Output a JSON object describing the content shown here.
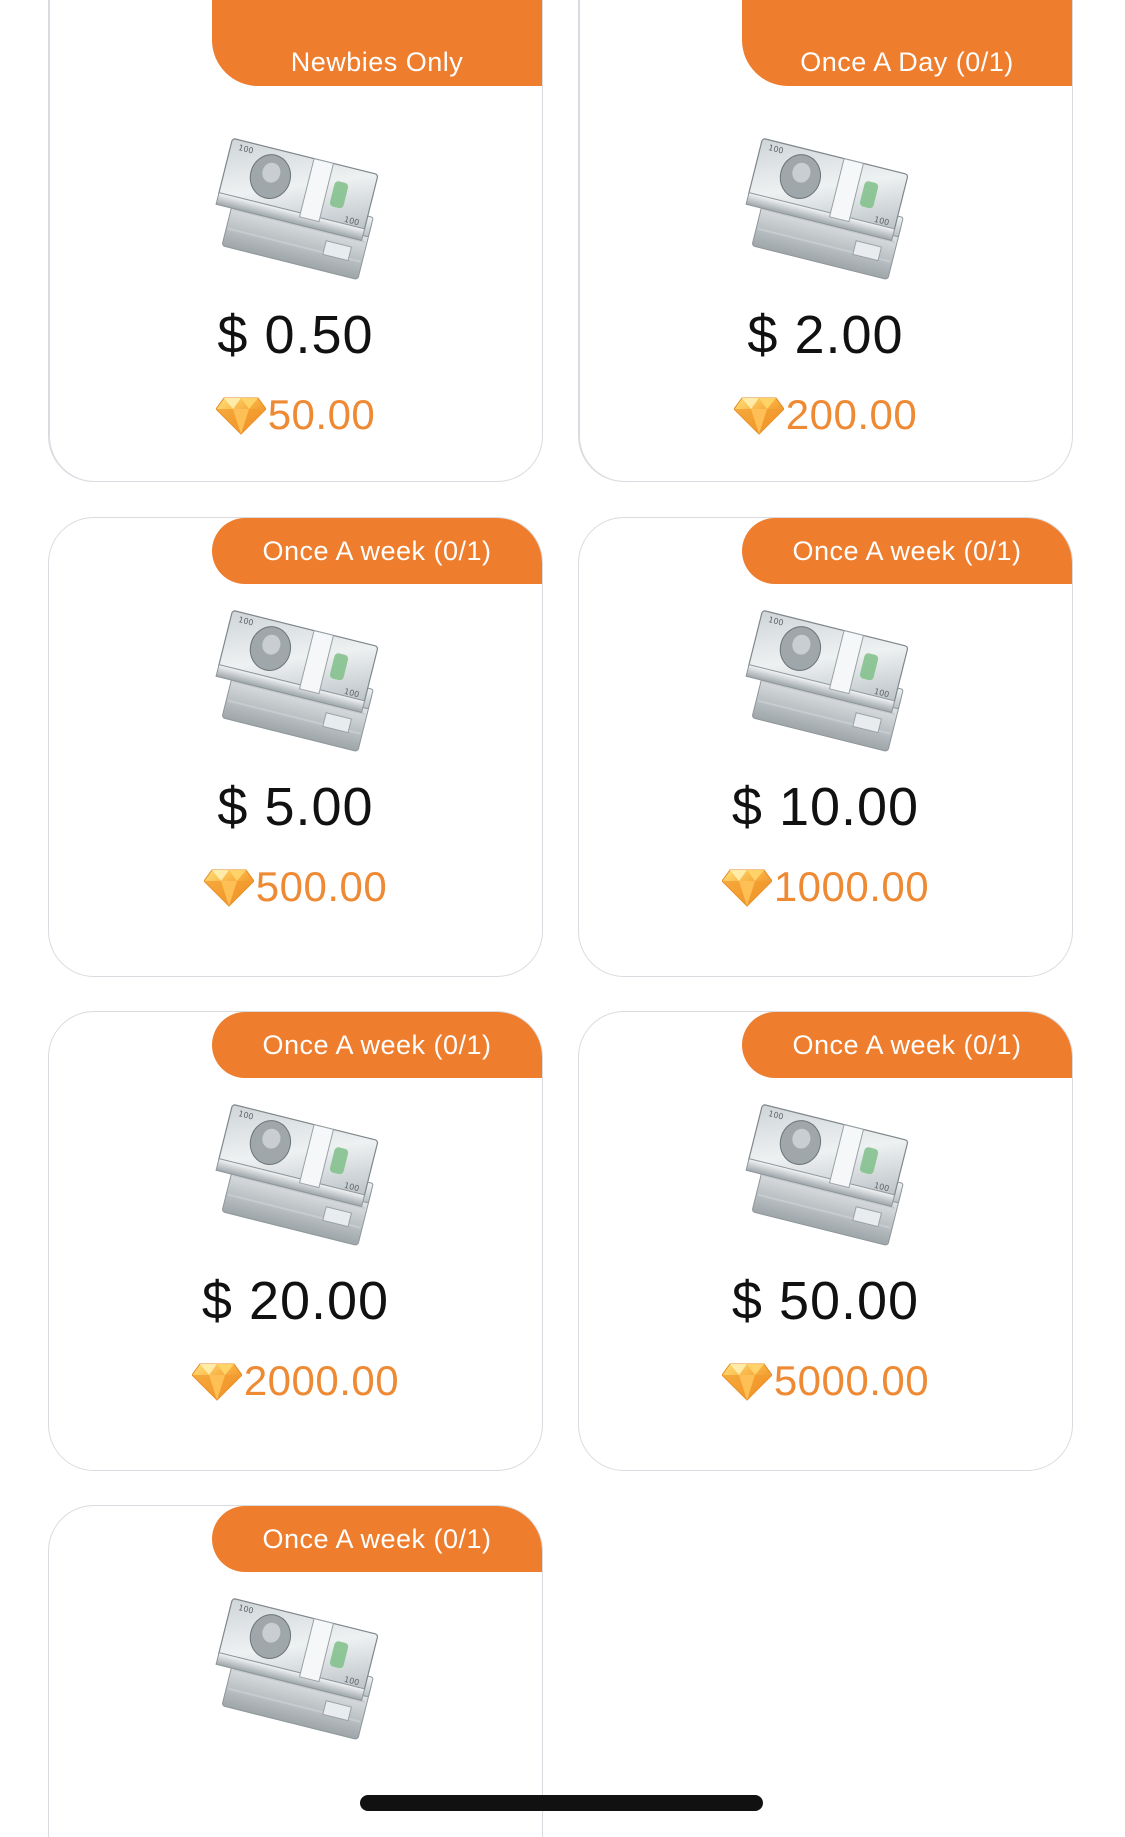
{
  "cards": [
    {
      "badge": "Newbies Only",
      "price": "$ 0.50",
      "gems": "50.00"
    },
    {
      "badge": "Once A Day (0/1)",
      "price": "$ 2.00",
      "gems": "200.00"
    },
    {
      "badge": "Once A week (0/1)",
      "price": "$ 5.00",
      "gems": "500.00"
    },
    {
      "badge": "Once A week (0/1)",
      "price": "$ 10.00",
      "gems": "1000.00"
    },
    {
      "badge": "Once A week (0/1)",
      "price": "$ 20.00",
      "gems": "2000.00"
    },
    {
      "badge": "Once A week (0/1)",
      "price": "$ 50.00",
      "gems": "5000.00"
    },
    {
      "badge": "Once A week (0/1)",
      "price": "",
      "gems": ""
    }
  ],
  "colors": {
    "accent": "#ee7d2e",
    "gem_text": "#ee8a34",
    "border": "#d9dbe0"
  },
  "icons": {
    "cash": "cash-stack-icon",
    "gem": "diamond-gem-icon"
  }
}
